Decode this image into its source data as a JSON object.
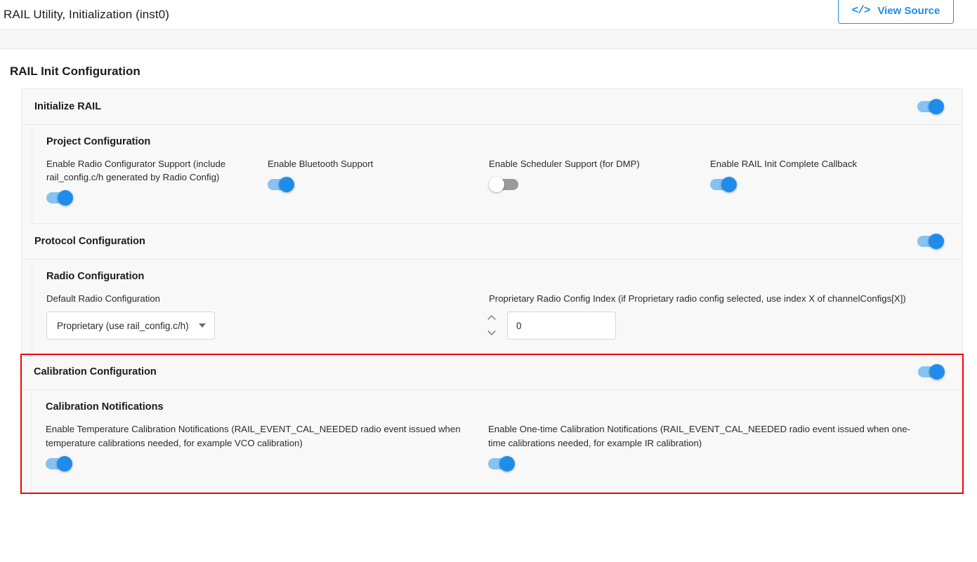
{
  "window": {
    "title": "RAIL Utility, Initialization (inst0)"
  },
  "toolbar": {
    "view_source_label": "View Source",
    "view_source_icon": "code-angle-brackets-icon",
    "view_source_icon_glyph": "</>"
  },
  "page": {
    "heading": "RAIL Init Configuration"
  },
  "colors": {
    "accent_blue": "#1f8ceb",
    "toggle_track_on": "#86c2f2",
    "toggle_track_off": "#9a9a9a",
    "highlight_red": "#fb0007",
    "panel_bg": "#f8f8f8"
  },
  "sections": {
    "initialize_rail": {
      "title": "Initialize RAIL",
      "toggle_state": "on",
      "project_configuration": {
        "title": "Project Configuration",
        "fields": [
          {
            "label": "Enable Radio Configurator Support (include rail_config.c/h generated by Radio Config)",
            "toggle_state": "on"
          },
          {
            "label": "Enable Bluetooth Support",
            "toggle_state": "on"
          },
          {
            "label": "Enable Scheduler Support (for DMP)",
            "toggle_state": "off"
          },
          {
            "label": "Enable RAIL Init Complete Callback",
            "toggle_state": "on"
          }
        ]
      }
    },
    "protocol_configuration": {
      "title": "Protocol Configuration",
      "toggle_state": "on",
      "radio_configuration": {
        "title": "Radio Configuration",
        "default_radio_config": {
          "label": "Default Radio Configuration",
          "value": "Proprietary (use rail_config.c/h)",
          "caret_icon": "chevron-down-icon"
        },
        "proprietary_index": {
          "label": "Proprietary Radio Config Index (if Proprietary radio config selected, use index X of channelConfigs[X])",
          "value": "0",
          "up_icon": "chevron-up-icon",
          "down_icon": "chevron-down-icon"
        }
      }
    },
    "calibration_configuration": {
      "title": "Calibration Configuration",
      "toggle_state": "on",
      "highlighted": true,
      "calibration_notifications": {
        "title": "Calibration Notifications",
        "fields": [
          {
            "label": "Enable Temperature Calibration Notifications (RAIL_EVENT_CAL_NEEDED radio event issued when temperature calibrations needed, for example VCO calibration)",
            "toggle_state": "on"
          },
          {
            "label": "Enable One-time Calibration Notifications (RAIL_EVENT_CAL_NEEDED radio event issued when one-time calibrations needed, for example IR calibration)",
            "toggle_state": "on"
          }
        ]
      }
    }
  }
}
